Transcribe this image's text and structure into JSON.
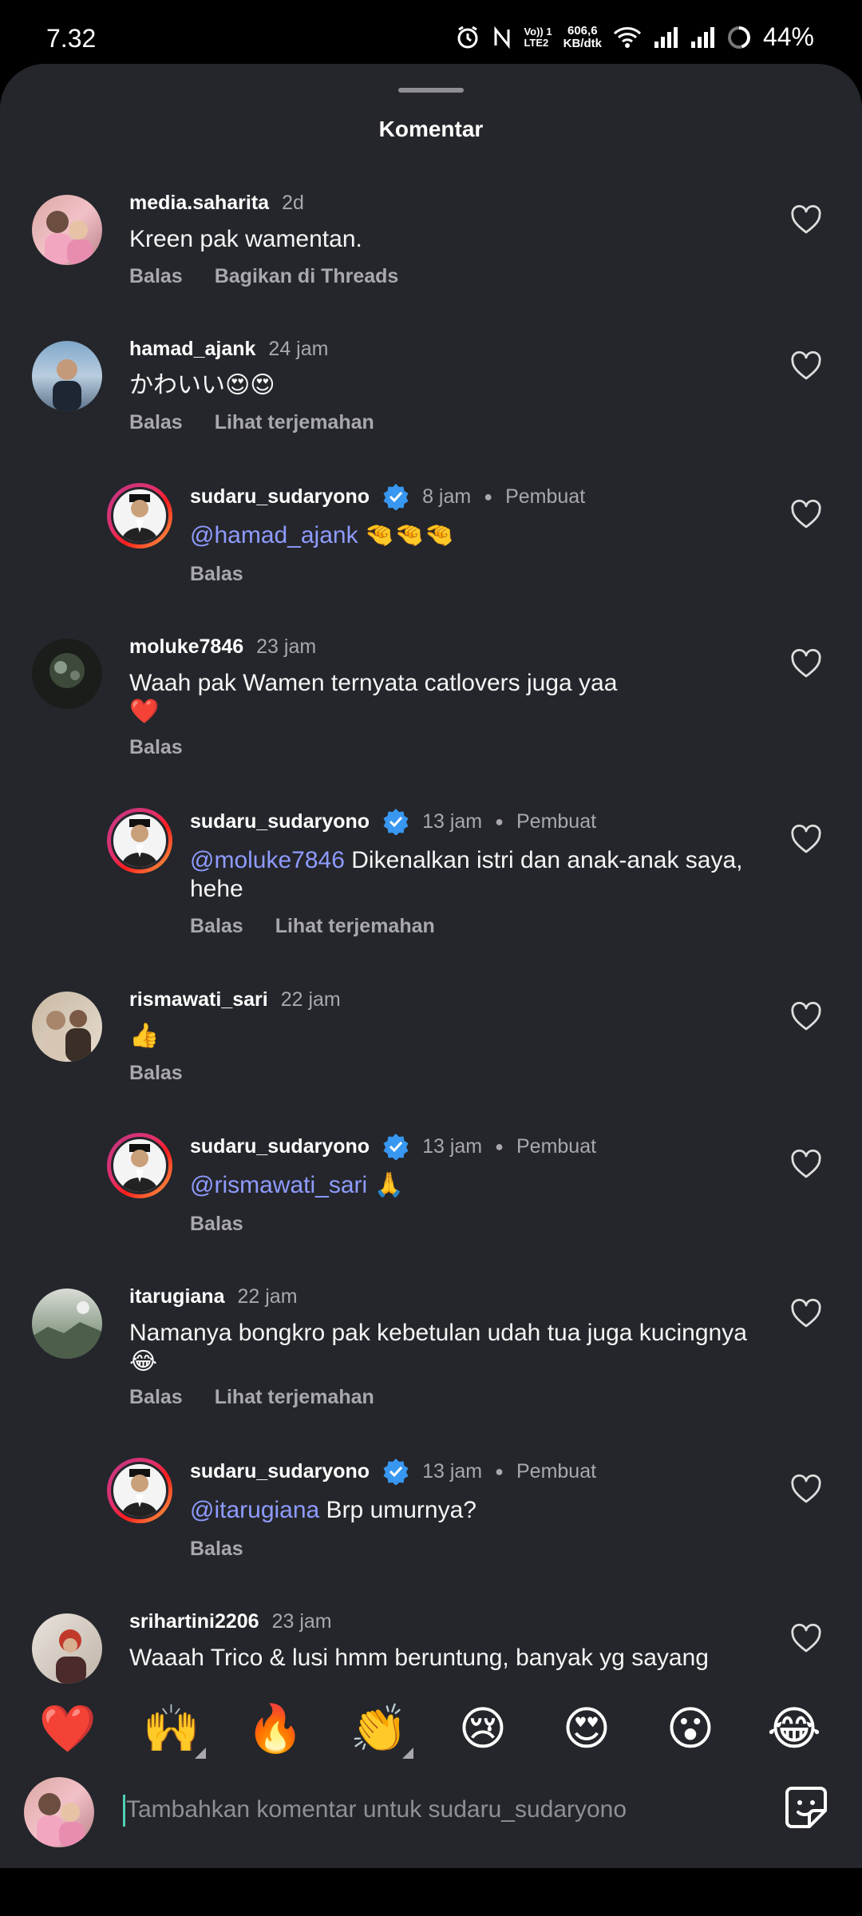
{
  "status_bar": {
    "time": "7.32",
    "lte": "Vo)) 1\nLTE2",
    "network_speed": "606,6\nKB/dtk",
    "battery": "44%"
  },
  "sheet": {
    "title": "Komentar"
  },
  "comments": [
    {
      "username": "media.saharita",
      "time": "2d",
      "text": "Kreen pak wamentan.",
      "actions": [
        "Balas",
        "Bagikan di Threads"
      ]
    },
    {
      "username": "hamad_ajank",
      "time": "24 jam",
      "text": "かわいい😍😍",
      "actions": [
        "Balas",
        "Lihat terjemahan"
      ]
    },
    {
      "username": "sudaru_sudaryono",
      "time": "8 jam",
      "role": "Pembuat",
      "mention": "@hamad_ajank",
      "text": " 🤏🤏🤏",
      "actions": [
        "Balas"
      ]
    },
    {
      "username": "moluke7846",
      "time": "23 jam",
      "text": "Waah pak Wamen ternyata catlovers juga yaa",
      "text2": "❤️",
      "actions": [
        "Balas"
      ]
    },
    {
      "username": "sudaru_sudaryono",
      "time": "13 jam",
      "role": "Pembuat",
      "mention": "@moluke7846",
      "text": " Dikenalkan istri dan anak-anak saya,",
      "text2": "hehe",
      "actions": [
        "Balas",
        "Lihat terjemahan"
      ]
    },
    {
      "username": "rismawati_sari",
      "time": "22 jam",
      "text": "👍",
      "actions": [
        "Balas"
      ]
    },
    {
      "username": "sudaru_sudaryono",
      "time": "13 jam",
      "role": "Pembuat",
      "mention": "@rismawati_sari",
      "text": " 🙏",
      "actions": [
        "Balas"
      ]
    },
    {
      "username": "itarugiana",
      "time": "22 jam",
      "text": "Namanya bongkro pak kebetulan udah tua juga kucingnya",
      "text2": "😂",
      "actions": [
        "Balas",
        "Lihat terjemahan"
      ]
    },
    {
      "username": "sudaru_sudaryono",
      "time": "13 jam",
      "role": "Pembuat",
      "mention": "@itarugiana",
      "text": " Brp umurnya?",
      "actions": [
        "Balas"
      ]
    },
    {
      "username": "srihartini2206",
      "time": "23 jam",
      "text": "Waaah Trico & lusi  hmm beruntung, banyak yg sayang"
    }
  ],
  "quick_reactions": [
    "❤️",
    "🙌",
    "🔥",
    "👏",
    "😢",
    "😍",
    "😮",
    "😂"
  ],
  "composer": {
    "placeholder": "Tambahkan komentar untuk sudaru_sudaryono"
  },
  "colors": {
    "background": "#24262b",
    "mention": "#8f9bff",
    "verified": "#3897f0"
  }
}
